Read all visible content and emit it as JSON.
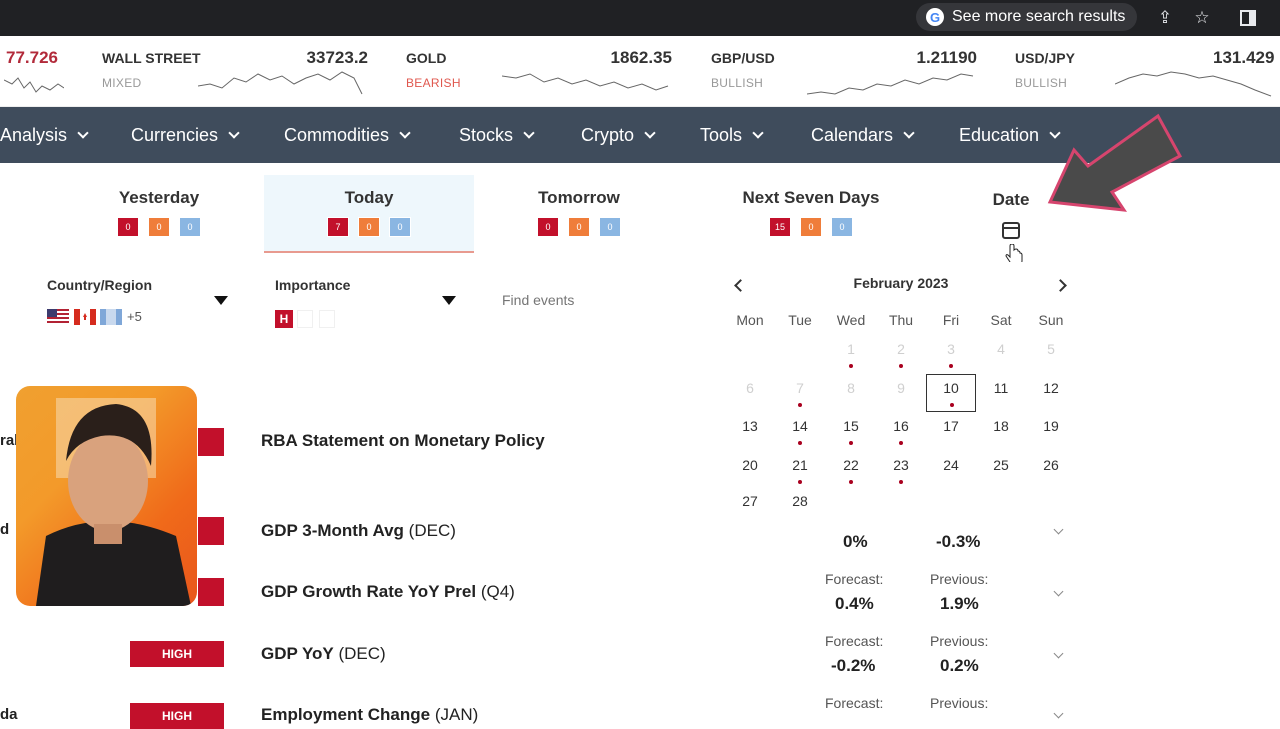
{
  "browser": {
    "search_more": "See more search results",
    "icons": [
      "google-icon",
      "share-icon",
      "star-icon",
      "sidebar-icon"
    ]
  },
  "ticker": [
    {
      "name": "",
      "value": "77.726",
      "sentiment": ""
    },
    {
      "name": "WALL STREET",
      "value": "33723.2",
      "sentiment": "MIXED"
    },
    {
      "name": "GOLD",
      "value": "1862.35",
      "sentiment": "BEARISH"
    },
    {
      "name": "GBP/USD",
      "value": "1.21190",
      "sentiment": "BULLISH"
    },
    {
      "name": "USD/JPY",
      "value": "131.429",
      "sentiment": "BULLISH"
    }
  ],
  "nav": {
    "items": [
      "Analysis",
      "Currencies",
      "Commodities",
      "Stocks",
      "Crypto",
      "Tools",
      "Calendars",
      "Education"
    ]
  },
  "day_tabs": [
    {
      "label": "Yesterday",
      "counts": [
        "0",
        "0",
        "0"
      ]
    },
    {
      "label": "Today",
      "counts": [
        "7",
        "0",
        "0"
      ]
    },
    {
      "label": "Tomorrow",
      "counts": [
        "0",
        "0",
        "0"
      ]
    },
    {
      "label": "Next Seven Days",
      "counts": [
        "15",
        "0",
        "0"
      ]
    }
  ],
  "date_tab": {
    "label": "Date"
  },
  "filters": {
    "country_label": "Country/Region",
    "country_more": "+5",
    "importance_label": "Importance",
    "importance_selected": "H",
    "search_placeholder": "Find events"
  },
  "calendar": {
    "month": "February 2023",
    "weekdays": [
      "Mon",
      "Tue",
      "Wed",
      "Thu",
      "Fri",
      "Sat",
      "Sun"
    ],
    "selected_day": "10"
  },
  "events": [
    {
      "country": "ral",
      "title": "RBA Statement on Monetary Policy",
      "period": "",
      "importance": ""
    },
    {
      "country": "d",
      "title": "GDP 3-Month Avg",
      "period": "(DEC)",
      "actual": "0%",
      "previous": "-0.3%"
    },
    {
      "country": "",
      "title": "GDP Growth Rate YoY Prel",
      "period": "(Q4)",
      "forecast_label": "Forecast:",
      "forecast": "0.4%",
      "previous_label": "Previous:",
      "previous": "1.9%"
    },
    {
      "country": "",
      "title": "GDP YoY",
      "period": "(DEC)",
      "importance": "HIGH",
      "forecast_label": "Forecast:",
      "forecast": "-0.2%",
      "previous_label": "Previous:",
      "previous": "0.2%"
    },
    {
      "country": "da",
      "title": "Employment Change",
      "period": "(JAN)",
      "importance": "HIGH",
      "forecast_label": "Forecast:",
      "previous_label": "Previous:"
    }
  ],
  "colors": {
    "nav_bg": "#3f4c5c",
    "high_red": "#c2102b",
    "medium_orange": "#ef7d3a",
    "low_blue": "#8ab6e2",
    "bearish": "#e0584f"
  }
}
